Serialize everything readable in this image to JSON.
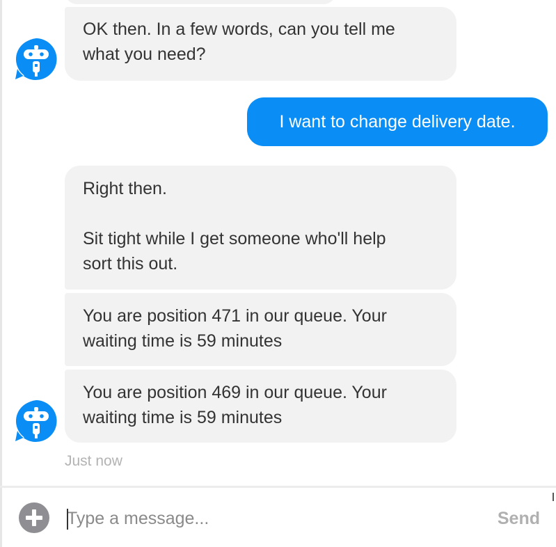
{
  "messages": [
    {
      "sender": "bot",
      "lines": [
        "OK then. In a few words, can you tell me",
        "what you need?"
      ]
    },
    {
      "sender": "user",
      "text": "I want to change delivery date."
    },
    {
      "sender": "bot",
      "lines": [
        "Right then.",
        "",
        "Sit tight while I get someone who'll help",
        "sort this out."
      ]
    },
    {
      "sender": "bot",
      "lines": [
        "You are position 471 in our queue. Your",
        "waiting time is 59 minutes"
      ]
    },
    {
      "sender": "bot",
      "lines": [
        "You are position 469 in our queue. Your",
        "waiting time is 59 minutes"
      ]
    }
  ],
  "timestamp": "Just now",
  "composer": {
    "placeholder": "Type a message...",
    "value": "",
    "send_label": "Send",
    "add_icon": "plus-circle-icon"
  },
  "avatar_icon": "robot-icon",
  "colors": {
    "user_bubble": "#0a8ef5",
    "bot_bubble": "#f2f2f2",
    "avatar": "#0a8ef5",
    "send_disabled": "#b0b0b0"
  }
}
